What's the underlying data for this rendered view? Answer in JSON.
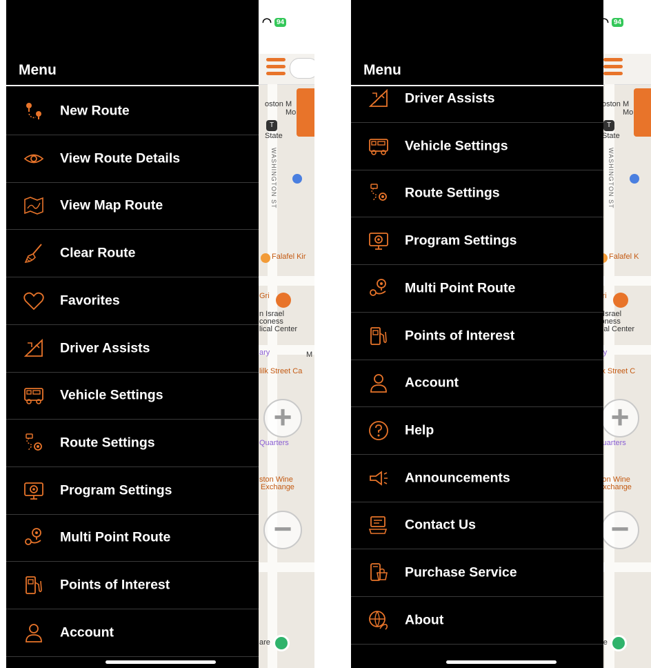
{
  "accent_color": "#e8742a",
  "left_screen": {
    "status": {
      "battery": "94"
    },
    "menu_title": "Menu",
    "items": [
      {
        "label": "New Route",
        "icon": "route-pins-icon"
      },
      {
        "label": "View Route Details",
        "icon": "eye-icon"
      },
      {
        "label": "View Map Route",
        "icon": "map-icon"
      },
      {
        "label": "Clear Route",
        "icon": "broom-icon"
      },
      {
        "label": "Favorites",
        "icon": "heart-icon"
      },
      {
        "label": "Driver Assists",
        "icon": "road-sign-icon"
      },
      {
        "label": "Vehicle Settings",
        "icon": "rv-vehicle-icon"
      },
      {
        "label": "Route Settings",
        "icon": "route-gear-icon"
      },
      {
        "label": "Program Settings",
        "icon": "monitor-gear-icon"
      },
      {
        "label": "Multi Point Route",
        "icon": "multi-pin-icon"
      },
      {
        "label": "Points of Interest",
        "icon": "fuel-pump-icon"
      },
      {
        "label": "Account",
        "icon": "person-icon"
      }
    ],
    "map_labels": {
      "boston": "oston M",
      "boston2": "Mo",
      "state": "State",
      "street": "WASHINGTON ST",
      "falafel": "Falafel Kir",
      "gri": "Gri",
      "israel": "n Israel",
      "coness": "coness",
      "medical": "lical Center",
      "ary": "ary",
      "m": "M",
      "milk": "lilk Street Ca",
      "quarters": "Quarters",
      "wine": "ston Wine",
      "exchange": "Exchange",
      "square": "are"
    }
  },
  "right_screen": {
    "status": {
      "battery": "94"
    },
    "menu_title": "Menu",
    "items": [
      {
        "label": "Driver Assists",
        "icon": "road-sign-icon"
      },
      {
        "label": "Vehicle Settings",
        "icon": "rv-vehicle-icon"
      },
      {
        "label": "Route Settings",
        "icon": "route-gear-icon"
      },
      {
        "label": "Program Settings",
        "icon": "monitor-gear-icon"
      },
      {
        "label": "Multi Point Route",
        "icon": "multi-pin-icon"
      },
      {
        "label": "Points of Interest",
        "icon": "fuel-pump-icon"
      },
      {
        "label": "Account",
        "icon": "person-icon"
      },
      {
        "label": "Help",
        "icon": "help-circle-icon"
      },
      {
        "label": "Announcements",
        "icon": "megaphone-icon"
      },
      {
        "label": "Contact Us",
        "icon": "contact-laptop-icon"
      },
      {
        "label": "Purchase Service",
        "icon": "mobile-purchase-icon"
      },
      {
        "label": "About",
        "icon": "globe-hand-icon"
      }
    ],
    "map_labels": {
      "boston": "oston M",
      "boston2": "Mo",
      "state": "State",
      "street": "WASHINGTON ST",
      "falafel": "Falafel K",
      "gri": "Gri",
      "israel": "n Israel",
      "coness": "coness",
      "medical": "lical Center",
      "ary": "ary",
      "milk": "lilk Street C",
      "quarters": "Quarters",
      "wine": "ston Wine",
      "exchange": "Exchange",
      "square": "are"
    }
  }
}
